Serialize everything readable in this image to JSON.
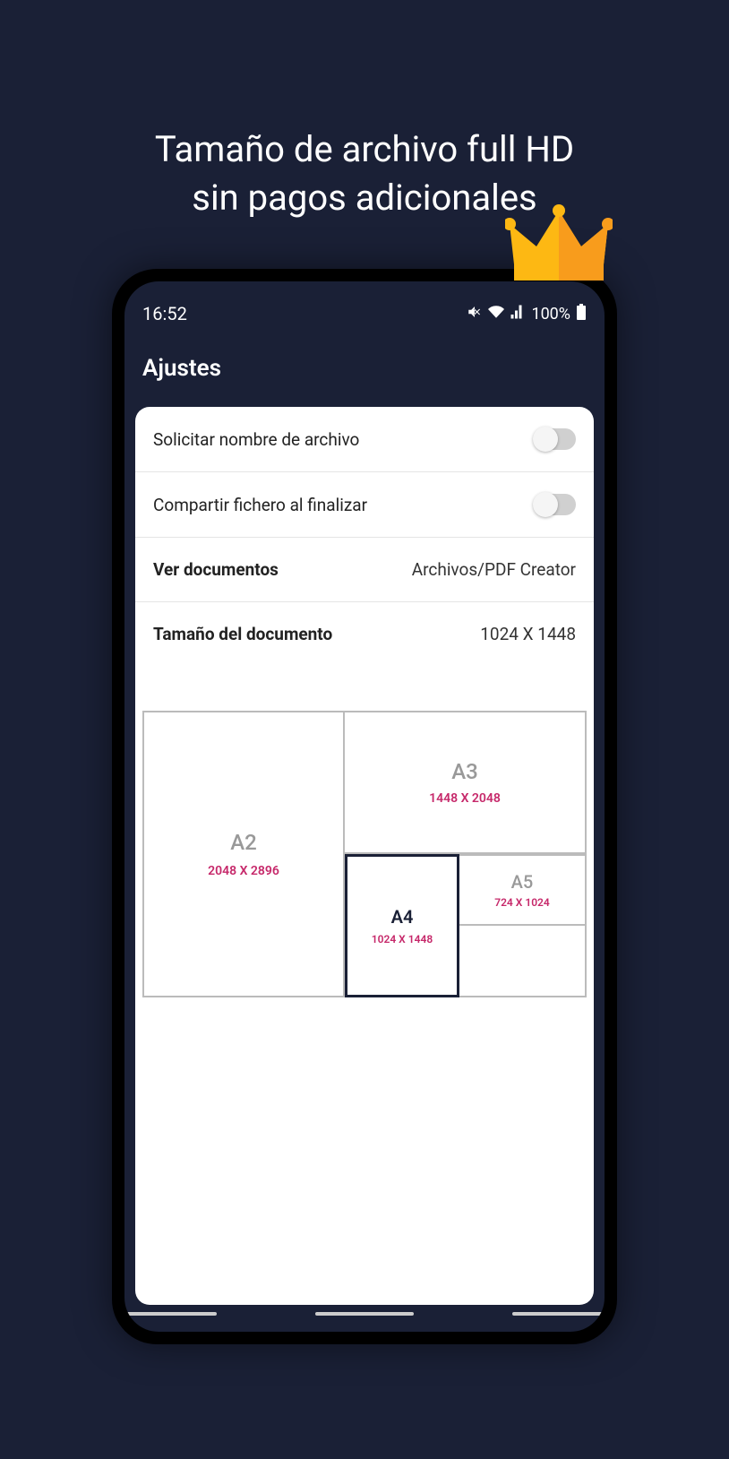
{
  "promo": {
    "line1": "Tamaño de archivo full HD",
    "line2": "sin pagos adicionales"
  },
  "statusBar": {
    "time": "16:52",
    "battery": "100%"
  },
  "header": {
    "title": "Ajustes"
  },
  "settings": {
    "requestFilename": {
      "label": "Solicitar nombre de archivo",
      "enabled": false
    },
    "shareOnFinish": {
      "label": "Compartir fichero al finalizar",
      "enabled": false
    },
    "viewDocuments": {
      "label": "Ver documentos",
      "value": "Archivos/PDF Creator"
    },
    "documentSize": {
      "label": "Tamaño del documento",
      "value": "1024 X 1448"
    }
  },
  "paperSizes": {
    "a2": {
      "label": "A2",
      "dims": "2048 X 2896"
    },
    "a3": {
      "label": "A3",
      "dims": "1448 X 2048"
    },
    "a4": {
      "label": "A4",
      "dims": "1024 X 1448"
    },
    "a5": {
      "label": "A5",
      "dims": "724 X 1024"
    }
  }
}
